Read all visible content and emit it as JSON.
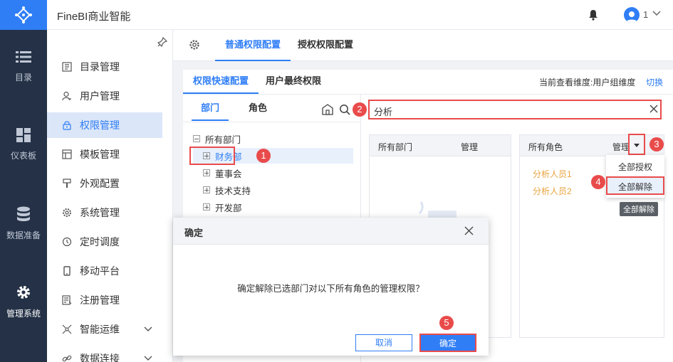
{
  "header": {
    "title": "FineBI商业智能",
    "user_count": "1"
  },
  "leftnav": [
    {
      "label": "目录",
      "icon": "list-icon"
    },
    {
      "label": "仪表板",
      "icon": "dashboard-icon"
    },
    {
      "label": "数据准备",
      "icon": "database-icon"
    },
    {
      "label": "管理系统",
      "icon": "gear-icon",
      "active": true
    }
  ],
  "submenu": [
    {
      "label": "目录管理",
      "icon": "catalog-icon"
    },
    {
      "label": "用户管理",
      "icon": "user-icon"
    },
    {
      "label": "权限管理",
      "icon": "lock-icon",
      "active": true
    },
    {
      "label": "模板管理",
      "icon": "template-icon"
    },
    {
      "label": "外观配置",
      "icon": "brush-icon"
    },
    {
      "label": "系统管理",
      "icon": "gear-icon"
    },
    {
      "label": "定时调度",
      "icon": "clock-icon"
    },
    {
      "label": "移动平台",
      "icon": "mobile-icon"
    },
    {
      "label": "注册管理",
      "icon": "register-icon"
    },
    {
      "label": "智能运维",
      "icon": "ops-icon",
      "expandable": true
    },
    {
      "label": "数据连接",
      "icon": "link-icon",
      "expandable": true
    }
  ],
  "main": {
    "tabs": [
      "普通权限配置",
      "授权权限配置"
    ],
    "subtabs": [
      "权限快速配置",
      "用户最终权限"
    ],
    "dimension_text": "当前查看维度:用户组维度",
    "switch_label": "切换",
    "dept_tabs": [
      "部门",
      "角色"
    ],
    "tree": [
      "所有部门",
      "财务部",
      "董事会",
      "技术支持",
      "开发部"
    ],
    "search_value": "分析",
    "card_left": {
      "h1": "所有部门",
      "h2": "管理"
    },
    "card_right": {
      "h1": "所有角色",
      "h2": "管理",
      "roles": [
        "分析人员1",
        "分析人员2"
      ]
    },
    "dropdown": [
      "全部授权",
      "全部解除"
    ],
    "tooltip": "全部解除"
  },
  "modal": {
    "title": "确定",
    "message": "确定解除已选部门对以下所有角色的管理权限？",
    "cancel": "取消",
    "ok": "确定"
  },
  "badges": [
    "1",
    "2",
    "3",
    "4",
    "5"
  ],
  "colors": {
    "accent": "#2f7ef6",
    "nav_bg": "#243146",
    "highlight": "#e94b4b",
    "role": "#e8a33d"
  }
}
